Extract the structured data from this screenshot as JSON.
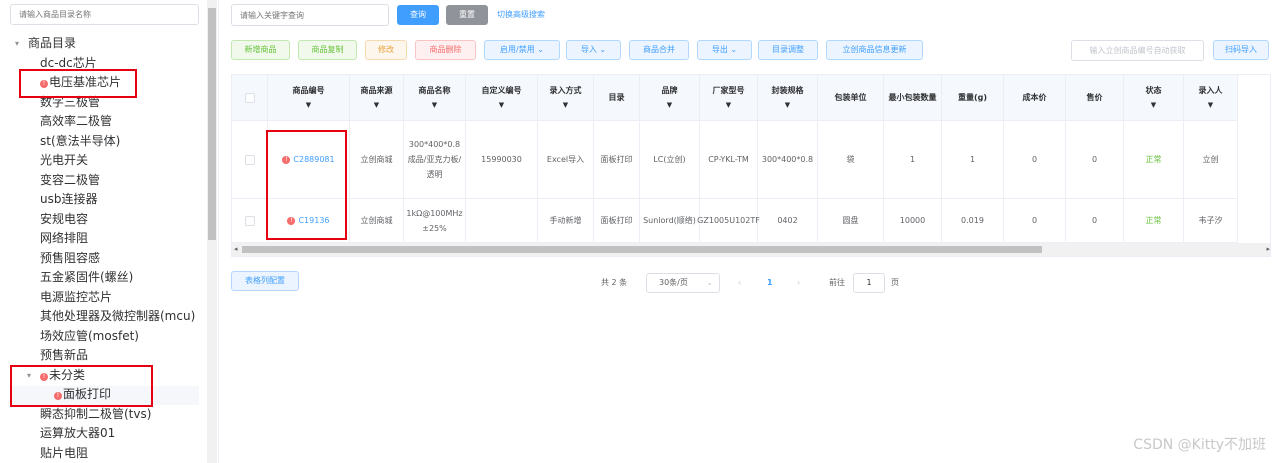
{
  "tree": {
    "search_placeholder": "请输入商品目录名称",
    "nodes": [
      {
        "label": "商品目录",
        "level": 0,
        "expanded": true,
        "warn": false
      },
      {
        "label": "dc-dc芯片",
        "level": 1,
        "warn": false
      },
      {
        "label": "电压基准芯片",
        "level": 1,
        "warn": true
      },
      {
        "label": "数字三极管",
        "level": 1,
        "warn": false
      },
      {
        "label": "高效率二极管",
        "level": 1,
        "warn": false
      },
      {
        "label": "st(意法半导体)",
        "level": 1,
        "warn": false
      },
      {
        "label": "光电开关",
        "level": 1,
        "warn": false
      },
      {
        "label": "变容二极管",
        "level": 1,
        "warn": false
      },
      {
        "label": "usb连接器",
        "level": 1,
        "warn": false
      },
      {
        "label": "安规电容",
        "level": 1,
        "warn": false
      },
      {
        "label": "网络排阻",
        "level": 1,
        "warn": false
      },
      {
        "label": "预售阻容感",
        "level": 1,
        "warn": false
      },
      {
        "label": "五金紧固件(螺丝)",
        "level": 1,
        "warn": false
      },
      {
        "label": "电源监控芯片",
        "level": 1,
        "warn": false
      },
      {
        "label": "其他处理器及微控制器(mcu)",
        "level": 1,
        "warn": false
      },
      {
        "label": "场效应管(mosfet)",
        "level": 1,
        "warn": false
      },
      {
        "label": "预售新品",
        "level": 1,
        "warn": false
      },
      {
        "label": "未分类",
        "level": 1,
        "expanded": true,
        "warn": true
      },
      {
        "label": "面板打印",
        "level": 2,
        "warn": true,
        "selected": true
      },
      {
        "label": "瞬态抑制二极管(tvs)",
        "level": 1,
        "warn": false
      },
      {
        "label": "运算放大器01",
        "level": 1,
        "warn": false
      },
      {
        "label": "贴片电阻",
        "level": 1,
        "warn": false
      }
    ]
  },
  "search": {
    "keyword_placeholder": "请输入关键字查询",
    "query_label": "查询",
    "reset_label": "重置",
    "advanced_label": "切换高级搜索"
  },
  "toolbar": {
    "add": "新增商品",
    "copy": "商品复制",
    "edit": "修改",
    "delete": "商品删除",
    "toggle": "启用/禁用",
    "import": "导入",
    "merge": "商品合并",
    "export": "导出",
    "catalog": "目录调整",
    "lc_update": "立创商品信息更新",
    "lc_input_placeholder": "输入立创商品编号自动获取",
    "scan_import": "扫码导入"
  },
  "table": {
    "columns": [
      "商品编号",
      "商品来源",
      "商品名称",
      "自定义编号",
      "录入方式",
      "目录",
      "品牌",
      "厂家型号",
      "封装规格",
      "包装单位",
      "最小包装数量",
      "重量(g)",
      "成本价",
      "售价",
      "状态",
      "录入人"
    ],
    "rows": [
      {
        "code": "C2889081",
        "source": "立创商城",
        "name": "300*400*0.8 成品/亚克力板/透明",
        "custom": "15990030",
        "method": "Excel导入",
        "catalog": "面板打印",
        "brand": "LC(立创)",
        "model": "CP-YKL-TM",
        "package": "300*400*0.8",
        "unit": "袋",
        "min_qty": "1",
        "weight": "1",
        "cost": "0",
        "price": "0",
        "status": "正常",
        "user": "立创"
      },
      {
        "code": "C19136",
        "source": "立创商城",
        "name": "1kΩ@100MHz ±25%",
        "custom": "",
        "method": "手动新增",
        "catalog": "面板打印",
        "brand": "Sunlord(顺络)",
        "model": "GZ1005U102TF",
        "package": "0402",
        "unit": "圆盘",
        "min_qty": "10000",
        "weight": "0.019",
        "cost": "0",
        "price": "0",
        "status": "正常",
        "user": "韦子汐"
      }
    ]
  },
  "footer": {
    "col_config": "表格列配置",
    "total": "共 2 条",
    "page_size": "30条/页",
    "current_page": "1",
    "goto_label": "前往",
    "goto_value": "1",
    "page_suffix": "页"
  },
  "watermark": "CSDN @Kitty不加班",
  "icons": {
    "caret_down": "caret-down-icon",
    "warning": "warning-icon",
    "filter": "filter-icon",
    "chevron_down": "chevron-down-icon"
  },
  "colors": {
    "primary": "#409eff",
    "success": "#67c23a",
    "danger": "#f56c6c",
    "highlight_box": "#e60012"
  }
}
